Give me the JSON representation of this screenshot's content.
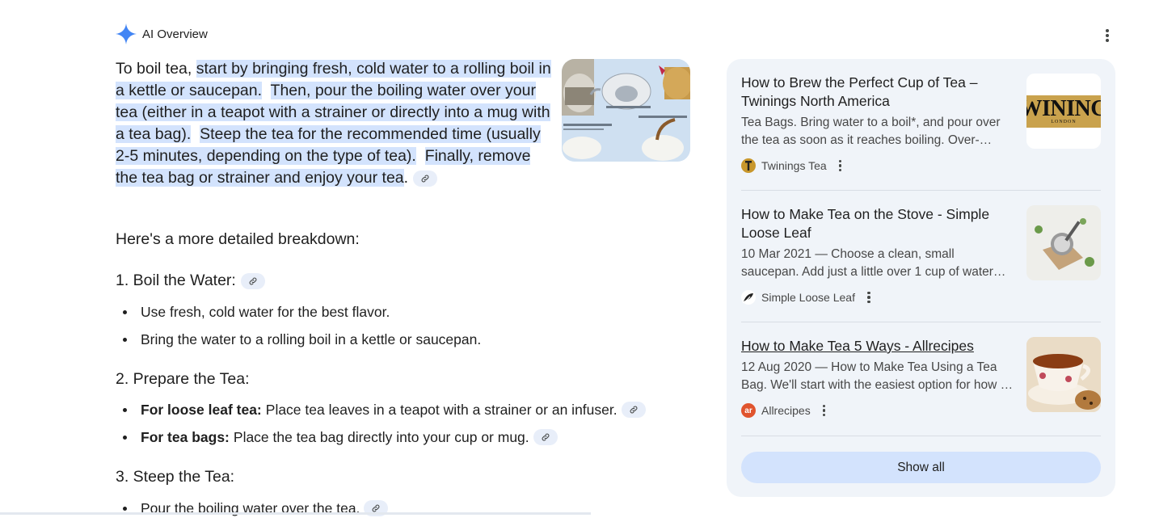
{
  "header": {
    "title": "AI Overview",
    "more_icon": "more-vert-icon"
  },
  "intro": {
    "lead": "To boil tea, ",
    "s1": "start by bringing fresh, cold water to a rolling boil in a kettle or saucepan.",
    "s2": "Then, pour the boiling water over your tea (either in a teapot with a strainer or directly into a mug with a tea bag).",
    "s3": "Steep the tea for the recom­mended time (usually 2-5 minutes, depending on the type of tea).",
    "s4a": "Finally, remove the tea bag or strainer and enjoy your tea",
    "s4b": "."
  },
  "breakdown_intro": "Here's a more detailed breakdown:",
  "steps": [
    {
      "title": "1. Boil the Water:",
      "items": [
        {
          "bold": "",
          "text": "Use fresh, cold water for the best flavor."
        },
        {
          "bold": "",
          "text": "Bring the water to a rolling boil in a kettle or saucepan."
        }
      ]
    },
    {
      "title": "2. Prepare the Tea:",
      "items": [
        {
          "bold": "For loose leaf tea:",
          "text": "Place tea leaves in a teapot with a strainer or an infuser."
        },
        {
          "bold": "For tea bags:",
          "text": "Place the tea bag directly into your cup or mug."
        }
      ]
    },
    {
      "title": "3. Steep the Tea:",
      "items": [
        {
          "bold": "",
          "text": "Pour the boiling water over the tea."
        }
      ]
    }
  ],
  "sources": [
    {
      "title": "How to Brew the Perfect Cup of Tea – Twinings North America",
      "snippet": "Tea Bags. Bring water to a boil*, and pour over the tea as soon as it reaches boiling. Over-steeping can cause bitterness.",
      "source": "Twinings Tea",
      "thumb_text": "WINING",
      "thumb_sub": "LONDON"
    },
    {
      "title": "How to Make Tea on the Stove - Simple Loose Leaf",
      "snippet": "10 Mar 2021 — Choose a clean, small saucepan. Add just a little over 1 cup of water per serving.",
      "source": "Simple Loose Leaf"
    },
    {
      "title": "How to Make Tea 5 Ways - Allrecipes",
      "snippet": "12 Aug 2020 — How to Make Tea Using a Tea Bag. We'll start with the easiest option for how to make tea.",
      "source": "Allrecipes",
      "favicon_text": "ar"
    }
  ],
  "show_all": "Show all",
  "colors": {
    "highlight": "#d3e3fd",
    "panel": "#f0f4f9",
    "accent": "#4285f4"
  }
}
